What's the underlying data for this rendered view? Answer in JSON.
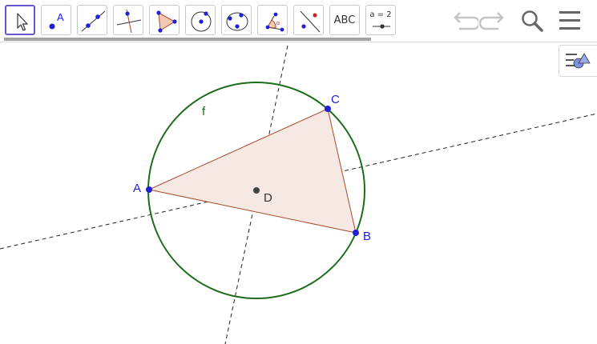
{
  "toolbar": {
    "tools": [
      {
        "name": "move-tool",
        "icon": "arrow-pointer-icon"
      },
      {
        "name": "point-tool",
        "icon": "point-icon",
        "label": "A"
      },
      {
        "name": "line-tool",
        "icon": "line-through-points-icon"
      },
      {
        "name": "perpendicular-line-tool",
        "icon": "perpendicular-line-icon"
      },
      {
        "name": "polygon-tool",
        "icon": "polygon-icon"
      },
      {
        "name": "circle-center-point-tool",
        "icon": "circle-center-icon"
      },
      {
        "name": "circle-three-points-tool",
        "icon": "circle-three-points-icon"
      },
      {
        "name": "angle-tool",
        "icon": "angle-icon"
      },
      {
        "name": "reflect-tool",
        "icon": "reflect-about-line-icon"
      },
      {
        "name": "text-tool",
        "icon": "text-icon",
        "label": "ABC"
      },
      {
        "name": "slider-tool",
        "icon": "slider-icon",
        "label": "a = 2"
      }
    ],
    "undo_icon": "undo-icon",
    "redo_icon": "redo-icon",
    "search_icon": "search-icon",
    "menu_icon": "hamburger-menu-icon",
    "style_bar_icon": "style-bar-toggle-icon"
  },
  "colors": {
    "point": "#1f1fd6",
    "point_label": "#1f1fd6",
    "circle": "#1b6d1b",
    "polygon_edge": "#a94a2a",
    "polygon_fill": "#f6e9e4",
    "dashed_line": "#222222",
    "center_point": "#444444",
    "selected_tool_border": "#6557d2"
  },
  "geometry": {
    "points": [
      {
        "name": "A",
        "label": "A"
      },
      {
        "name": "B",
        "label": "B"
      },
      {
        "name": "C",
        "label": "C"
      },
      {
        "name": "D",
        "label": "D"
      }
    ],
    "circle_label": "f"
  }
}
